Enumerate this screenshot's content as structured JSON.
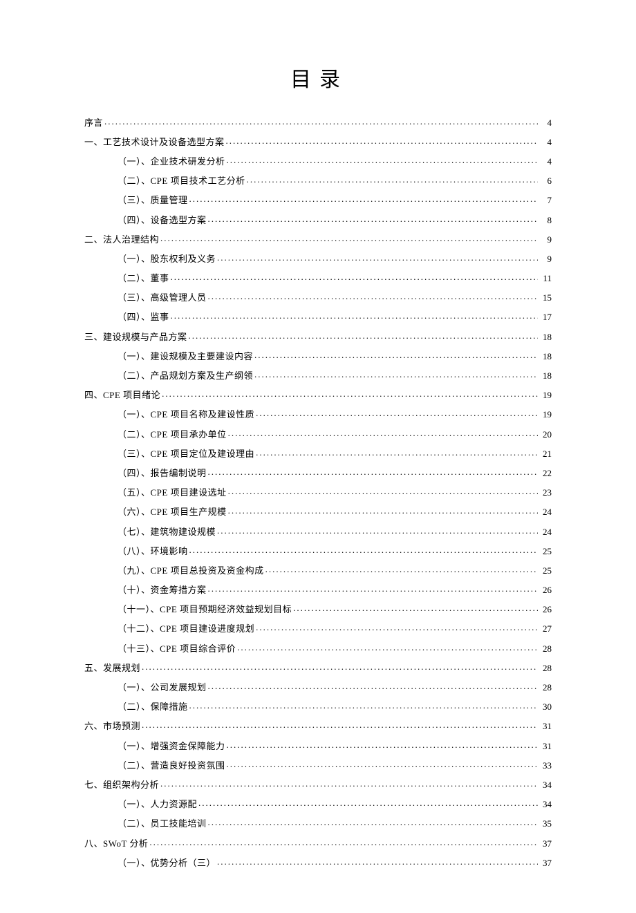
{
  "title": "目录",
  "toc": [
    {
      "level": 0,
      "label": "序言",
      "page": "4"
    },
    {
      "level": 0,
      "label": "一、工艺技术设计及设备选型方案",
      "page": "4"
    },
    {
      "level": 1,
      "label": "（一）、企业技术研发分析",
      "page": "4"
    },
    {
      "level": 1,
      "label": "（二）、CPE 项目技术工艺分析",
      "page": "6"
    },
    {
      "level": 1,
      "label": "（三）、质量管理",
      "page": "7"
    },
    {
      "level": 1,
      "label": "（四）、设备选型方案",
      "page": "8"
    },
    {
      "level": 0,
      "label": "二、法人治理结构",
      "page": "9"
    },
    {
      "level": 1,
      "label": "（一）、股东权利及义务",
      "page": "9"
    },
    {
      "level": 1,
      "label": "（二）、董事",
      "page": "11"
    },
    {
      "level": 1,
      "label": "（三）、高级管理人员",
      "page": "15"
    },
    {
      "level": 1,
      "label": "（四）、监事",
      "page": "17"
    },
    {
      "level": 0,
      "label": "三、建设规模与产品方案",
      "page": "18"
    },
    {
      "level": 1,
      "label": "（一）、建设规模及主要建设内容",
      "page": "18"
    },
    {
      "level": 1,
      "label": "（二）、产品规划方案及生产纲领",
      "page": "18"
    },
    {
      "level": 0,
      "label": "四、CPE 项目绪论",
      "page": "19"
    },
    {
      "level": 1,
      "label": "（一）、CPE 项目名称及建设性质",
      "page": "19"
    },
    {
      "level": 1,
      "label": "（二）、CPE 项目承办单位",
      "page": "20"
    },
    {
      "level": 1,
      "label": "（三）、CPE 项目定位及建设理由",
      "page": "21"
    },
    {
      "level": 1,
      "label": "（四）、报告编制说明",
      "page": "22"
    },
    {
      "level": 1,
      "label": "（五）、CPE 项目建设选址",
      "page": "23"
    },
    {
      "level": 1,
      "label": "（六）、CPE 项目生产规模",
      "page": "24"
    },
    {
      "level": 1,
      "label": "（七）、建筑物建设规模",
      "page": "24"
    },
    {
      "level": 1,
      "label": "（八）、环境影响",
      "page": "25"
    },
    {
      "level": 1,
      "label": "（九）、CPE 项目总投资及资金构成",
      "page": "25"
    },
    {
      "level": 1,
      "label": "（十）、资金筹措方案",
      "page": "26"
    },
    {
      "level": 1,
      "label": "（十一）、CPE 项目预期经济效益规划目标",
      "page": "26"
    },
    {
      "level": 1,
      "label": "（十二）、CPE 项目建设进度规划",
      "page": "27"
    },
    {
      "level": 1,
      "label": "（十三）、CPE 项目综合评价",
      "page": "28"
    },
    {
      "level": 0,
      "label": "五、发展规划",
      "page": "28"
    },
    {
      "level": 1,
      "label": "（一）、公司发展规划",
      "page": "28"
    },
    {
      "level": 1,
      "label": "（二）、保障措施",
      "page": "30"
    },
    {
      "level": 0,
      "label": "六、市场预测",
      "page": "31"
    },
    {
      "level": 1,
      "label": "（一）、增强资金保障能力",
      "page": "31"
    },
    {
      "level": 1,
      "label": "（二）、营造良好投资氛围",
      "page": "33"
    },
    {
      "level": 0,
      "label": "七、组织架构分析",
      "page": "34"
    },
    {
      "level": 1,
      "label": "（一）、人力资源配",
      "page": "34"
    },
    {
      "level": 1,
      "label": "（二）、员工技能培训",
      "page": "35"
    },
    {
      "level": 0,
      "label": "八、SWoT 分析",
      "page": "37"
    },
    {
      "level": 1,
      "label": "（一）、优势分析（三）",
      "page": "37"
    }
  ]
}
